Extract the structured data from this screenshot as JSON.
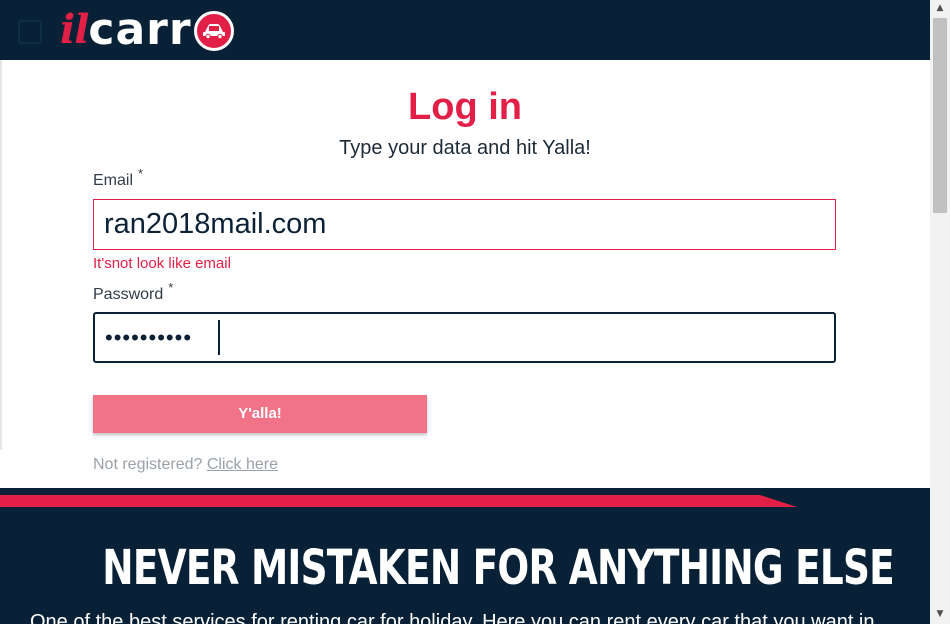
{
  "header": {
    "logo_prefix": "il",
    "logo_text": "carr"
  },
  "login": {
    "title": "Log in",
    "subtitle": "Type your data and hit Yalla!",
    "email_label": "Email",
    "required_mark": "*",
    "email_value": "ran2018mail.com",
    "email_error": "It'snot look like email",
    "password_label": "Password",
    "password_dots": "••••••••••",
    "submit_label": "Y'alla!",
    "not_registered": "Not registered?",
    "register_link": "Click here"
  },
  "footer": {
    "headline": "NEVER MISTAKEN FOR ANYTHING ELSE",
    "tagline": "One of the best services for renting car for holiday. Here you can rent every car that you want in"
  },
  "colors": {
    "brand_red": "#e21f46",
    "navy": "#082136",
    "button_pink": "#f27287"
  },
  "icons": [
    "menu-toggle-icon",
    "car-logo-icon",
    "scroll-up-arrow-icon",
    "scroll-down-arrow-icon"
  ]
}
